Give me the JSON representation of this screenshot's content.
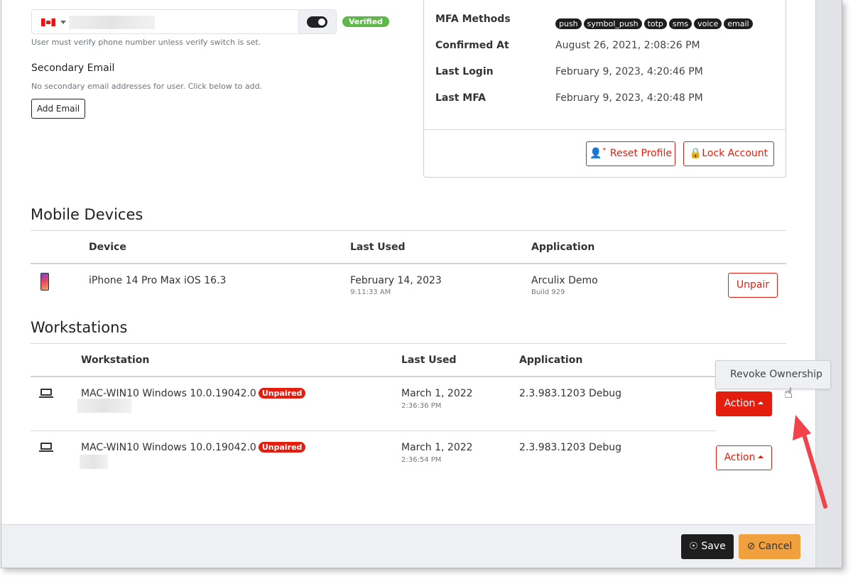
{
  "phone": {
    "hint": "User must verify phone number unless verify switch is set.",
    "verified_badge": "Verified",
    "verify_switch_on": true
  },
  "secondary_email": {
    "title": "Secondary Email",
    "empty_text": "No secondary email addresses for user. Click below to add.",
    "add_button": "Add Email"
  },
  "details": {
    "mfa_label": "MFA Methods",
    "mfa_methods": [
      "push",
      "symbol_push",
      "totp",
      "sms",
      "voice",
      "email"
    ],
    "rows": [
      {
        "label": "Confirmed At",
        "value": "August 26, 2021, 2:08:26 PM"
      },
      {
        "label": "Last Login",
        "value": "February 9, 2023, 4:20:46 PM"
      },
      {
        "label": "Last MFA",
        "value": "February 9, 2023, 4:20:48 PM"
      }
    ],
    "reset_button": "Reset Profile",
    "lock_button": "Lock Account"
  },
  "mobile": {
    "title": "Mobile Devices",
    "headers": [
      "Device",
      "Last Used",
      "Application"
    ],
    "rows": [
      {
        "device": "iPhone 14 Pro Max iOS 16.3",
        "date": "February 14, 2023",
        "time": "9:11:33 AM",
        "app": "Arculix Demo",
        "build": "Build 929",
        "button": "Unpair"
      }
    ]
  },
  "workstations": {
    "title": "Workstations",
    "headers": [
      "Workstation",
      "Last Used",
      "Application"
    ],
    "rows": [
      {
        "name": "MAC-WIN10 Windows 10.0.19042.0",
        "badge": "Unpaired",
        "date": "March 1, 2022",
        "time": "2:36:36 PM",
        "app": "2.3.983.1203 Debug",
        "button": "Action"
      },
      {
        "name": "MAC-WIN10 Windows 10.0.19042.0",
        "badge": "Unpaired",
        "date": "March 1, 2022",
        "time": "2:36:54 PM",
        "app": "2.3.983.1203 Debug",
        "button": "Action"
      }
    ],
    "dropdown_item": "Revoke Ownership"
  },
  "footer": {
    "save": "Save",
    "cancel": "Cancel"
  },
  "colors": {
    "accent_red": "#e31e0f",
    "verified_green": "#5cb848",
    "cancel_orange": "#f0a03c",
    "save_dark": "#1e1e1e"
  }
}
